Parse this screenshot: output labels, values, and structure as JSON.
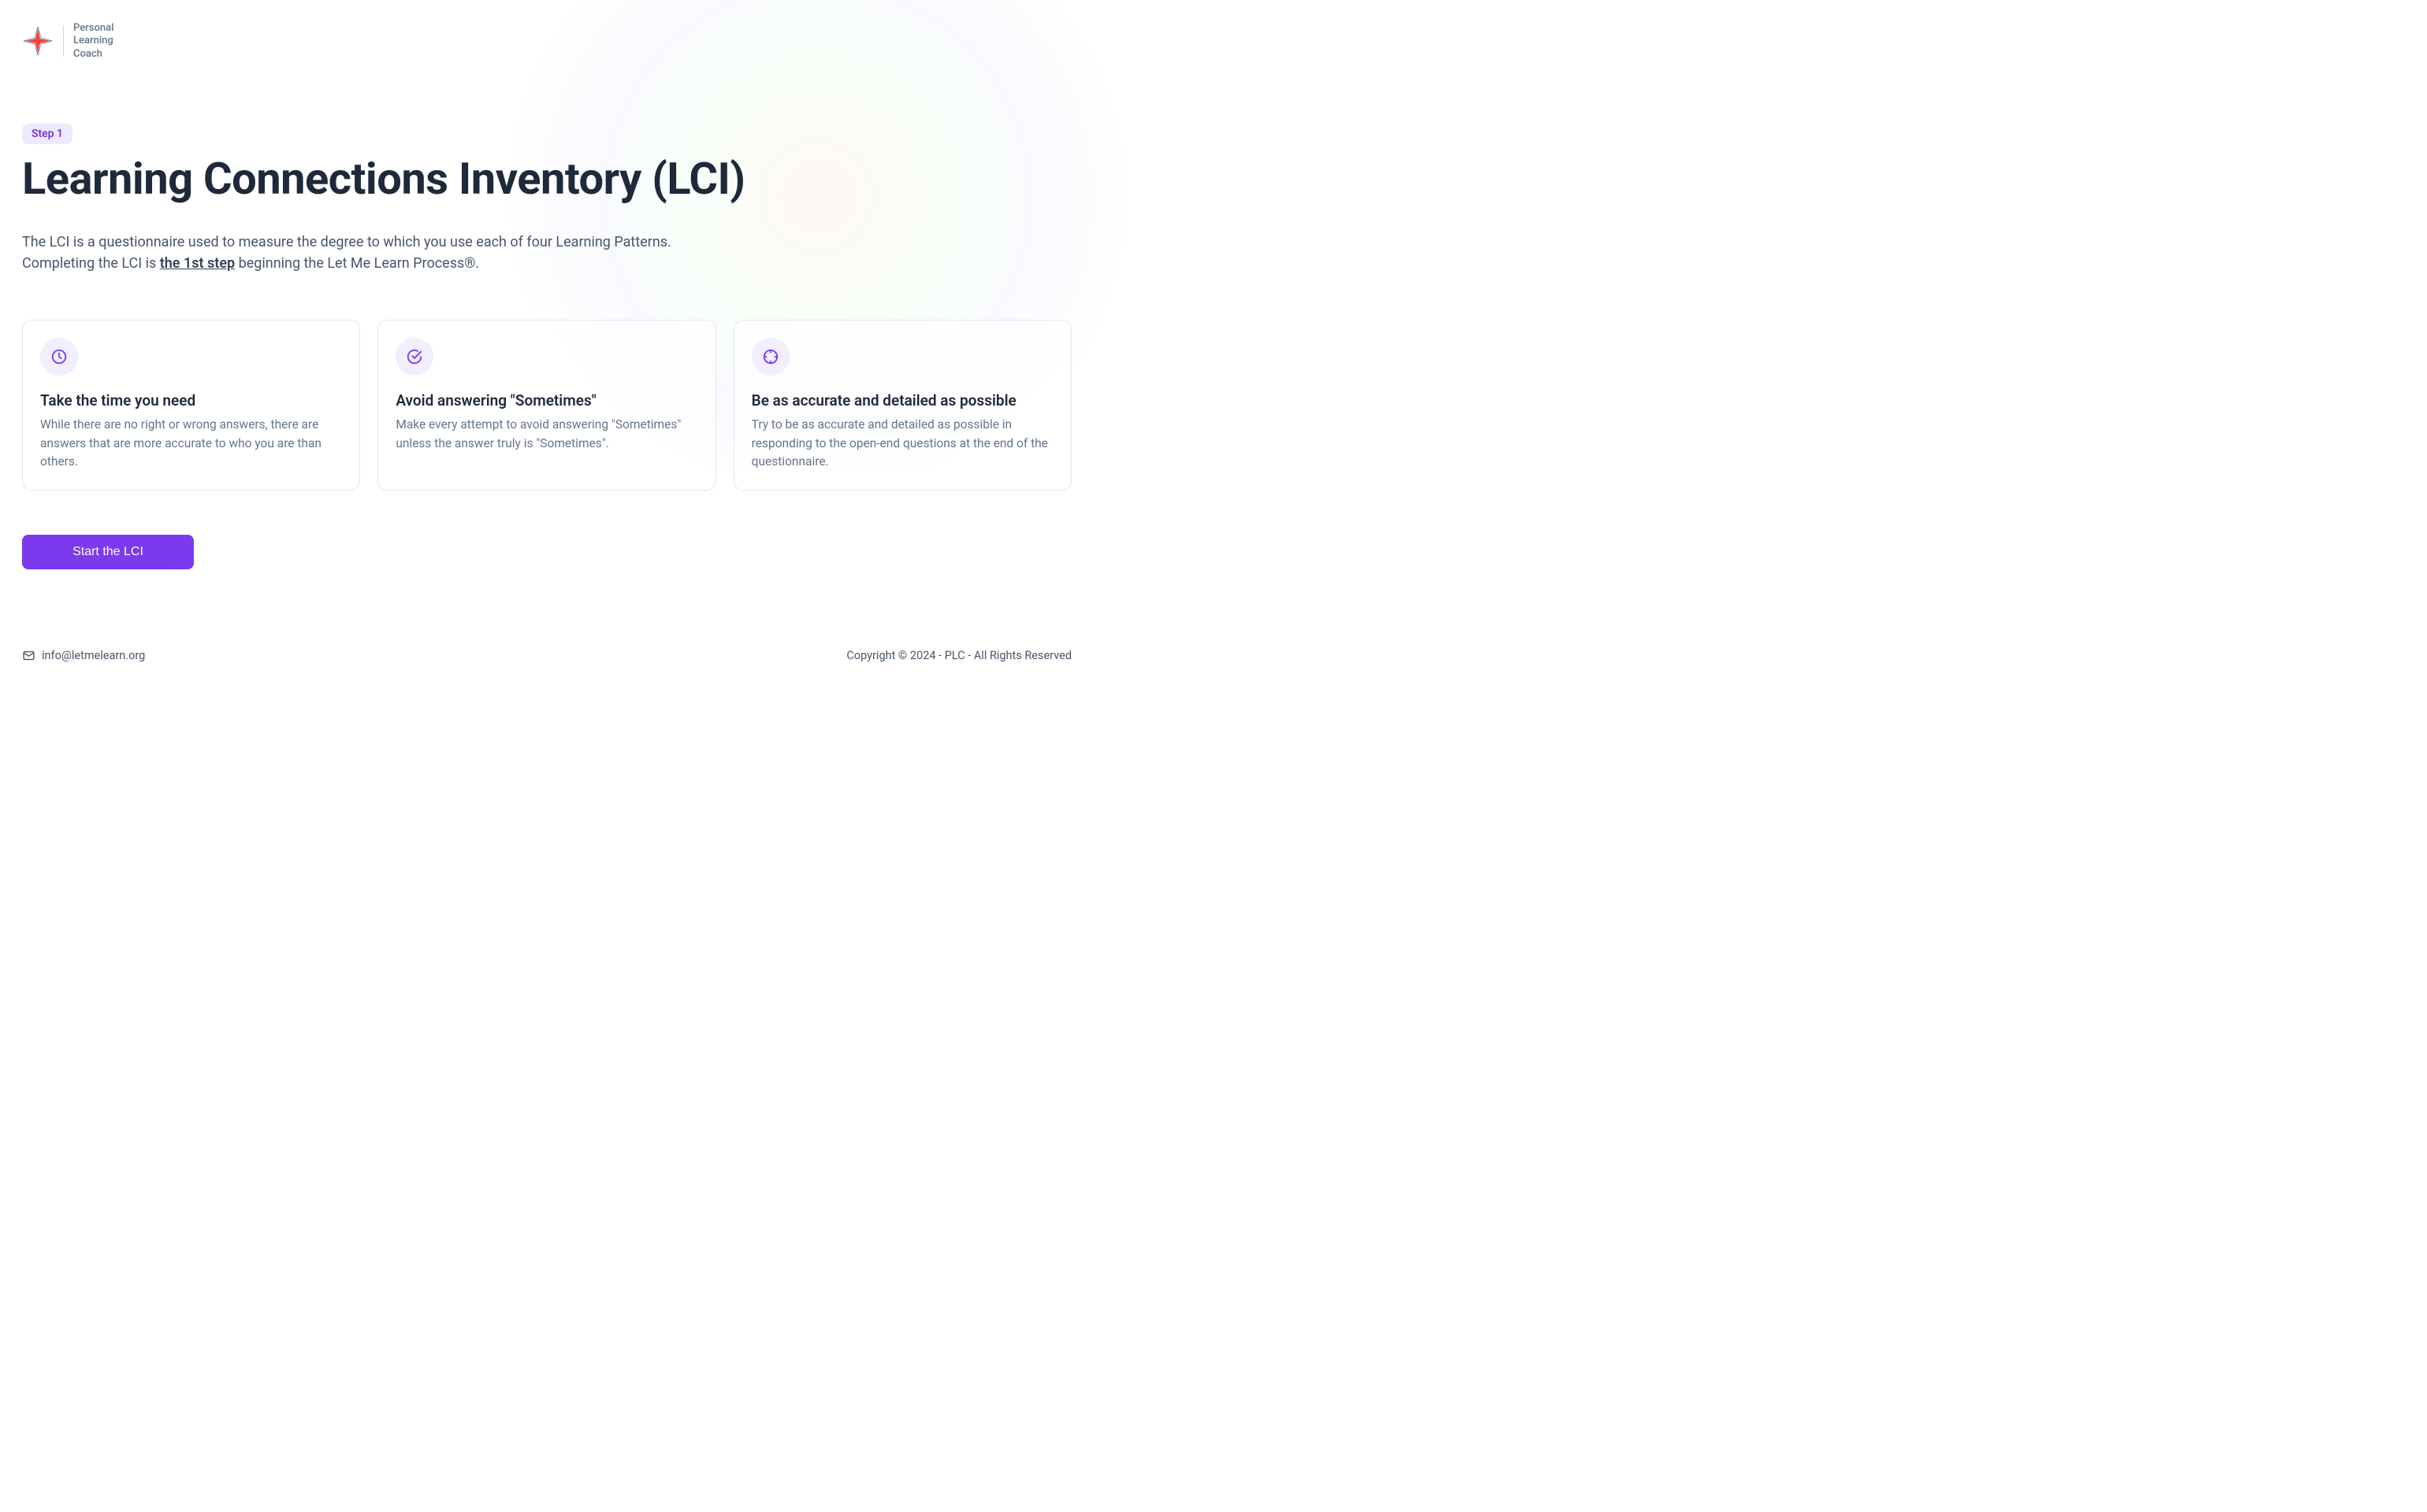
{
  "logo": {
    "line1": "Personal",
    "line2": "Learning",
    "line3": "Coach"
  },
  "badge": "Step 1",
  "title": "Learning Connections Inventory (LCI)",
  "subtitle_before": "The LCI is a questionnaire used to measure the degree to which you use each of four Learning Patterns. Completing the LCI is ",
  "subtitle_underline": "the 1st step",
  "subtitle_after": " beginning the Let Me Learn Process®.",
  "cards": [
    {
      "title": "Take the time you need",
      "body": "While there are no right or wrong answers, there are answers that are more accurate to who you are than others."
    },
    {
      "title": "Avoid answering \"Sometimes\"",
      "body": "Make every attempt to avoid answering \"Sometimes\" unless the answer truly is \"Sometimes\"."
    },
    {
      "title": "Be as accurate and detailed as possible",
      "body": "Try to be as accurate and detailed as possible in responding to the open-end questions at the end of the questionnaire."
    }
  ],
  "cta_label": "Start the LCI",
  "footer": {
    "email": "info@letmelearn.org",
    "copyright": "Copyright © 2024 - PLC - All Rights Reserved"
  }
}
